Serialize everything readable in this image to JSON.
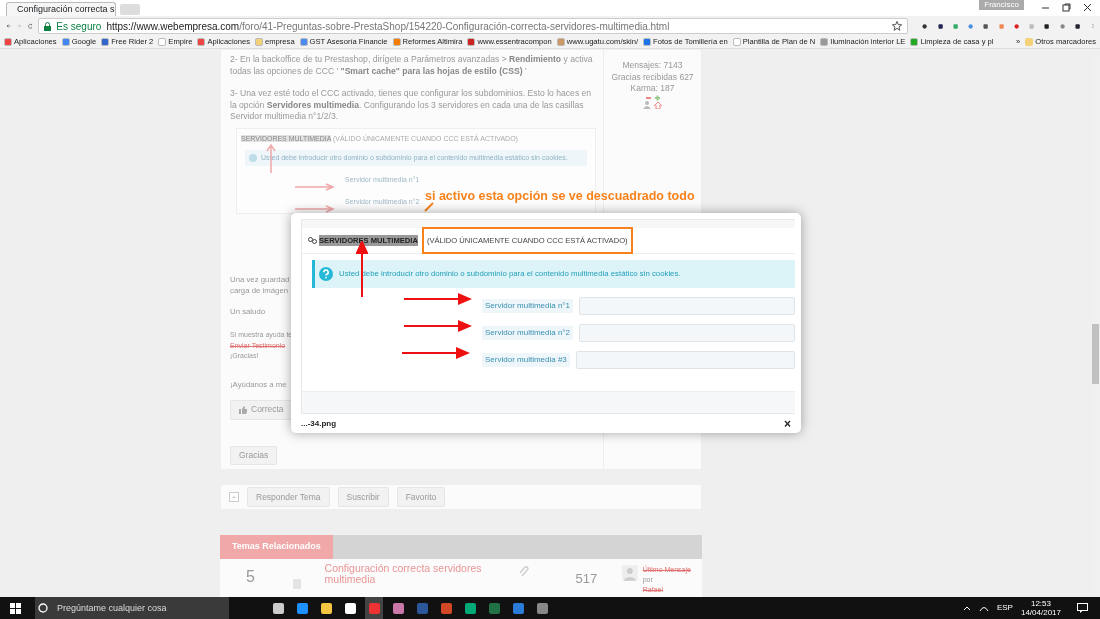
{
  "browser": {
    "tab_title": "Configuración correcta s",
    "user": "Francisco",
    "security": "Es seguro",
    "url_host": "https://www.webempresa.com",
    "url_path": "/foro/41-Preguntas-sobre-PrestaShop/154220-Configuración-correcta-servidores-multimedia.html",
    "bookmarks": [
      {
        "label": "Aplicaciones"
      },
      {
        "label": "Google"
      },
      {
        "label": "Free Rider 2"
      },
      {
        "label": "Empire"
      },
      {
        "label": "Aplicaciones"
      },
      {
        "label": "empresa"
      },
      {
        "label": "GST Asesoría Financie"
      },
      {
        "label": "Reformes Altimira"
      },
      {
        "label": "www.essentracompon"
      },
      {
        "label": "www.ugatu.com/skin/"
      },
      {
        "label": "Fotos de Tomillería en"
      },
      {
        "label": "Plantilla de Plan de N"
      },
      {
        "label": "Iluminación interior LE"
      },
      {
        "label": "Limpieza de casa y pl"
      }
    ],
    "more": "»",
    "other_bookmarks": "Otros marcadores"
  },
  "post": {
    "paragraphs": [
      "2- En la backoffice de tu Prestashop, dirígete a Parámetros avanzadas > **Rendimiento** y activa todas las opciones de CCC ' **\"Smart cache\" para las hojas de estilo (CSS)** '",
      "3- Una vez esté todo el CCC activado, tienes que configurar los subdominios. Esto lo haces en la opción **Servidores multimedia**. Configurando los 3 servidores en cada una de las casillas Servidor multimedia n°1/2/3."
    ],
    "embedded": {
      "title": "SERVIDORES MULTIMEDIA",
      "note": "(VÁLIDO ÚNICAMENTE CUANDO CCC ESTÁ ACTIVADO)",
      "info": "Usted debe introducir otro dominio o subdominio para el contenido multimedia estático sin cookies.",
      "fields": [
        "Servidor multimedia n°1",
        "Servidor multimedia n°2"
      ]
    },
    "lines_after": [
      {
        "kind": "text",
        "text": "Una vez guardad"
      },
      {
        "kind": "text",
        "text": "carga de imágen"
      },
      {
        "kind": "text",
        "text": "Un saludo"
      },
      {
        "kind": "small",
        "text": "Si muestra ayuda te"
      },
      {
        "kind": "link",
        "text": "Enviar Testimonio"
      },
      {
        "kind": "small",
        "text": "¡Gracias!"
      },
      {
        "kind": "text",
        "text": "¡Ayúdanos a me"
      }
    ],
    "correct_button": "Correcta",
    "thanks_button": "Gracias"
  },
  "author": {
    "stats": [
      "Mensajes: 7143",
      "Gracias recibidas 627",
      "Karma: 187"
    ]
  },
  "actions": [
    "Responder Tema",
    "Suscribir",
    "Favorito"
  ],
  "related": {
    "title": "Temas Relacionados",
    "topic": {
      "replies": "5",
      "title": "Configuración correcta servidores multimedia",
      "views": "517",
      "last_label": "Último Mensaje",
      "by": "por",
      "author": "Rafael"
    }
  },
  "lightbox": {
    "panel_title": "SERVIDORES MULTIMEDIA",
    "panel_note": "(VÁLIDO ÚNICAMENTE CUANDO CCC ESTÁ ACTIVADO)",
    "info": "Usted debe introducir otro dominio o subdominio para el contenido multimedia estático sin cookies.",
    "fields": [
      {
        "label": "Servidor multimedia n°1"
      },
      {
        "label": "Servidor multimedia n°2"
      },
      {
        "label": "Servidor multimedia #3"
      }
    ],
    "caption": "...-34.png",
    "close": "×"
  },
  "annotation": {
    "text": "si activo esta opción se ve descuadrado todo"
  },
  "taskbar": {
    "search_placeholder": "Pregúntame cualquier cosa",
    "language": "ESP",
    "time": "12:53",
    "date": "14/04/2017"
  }
}
